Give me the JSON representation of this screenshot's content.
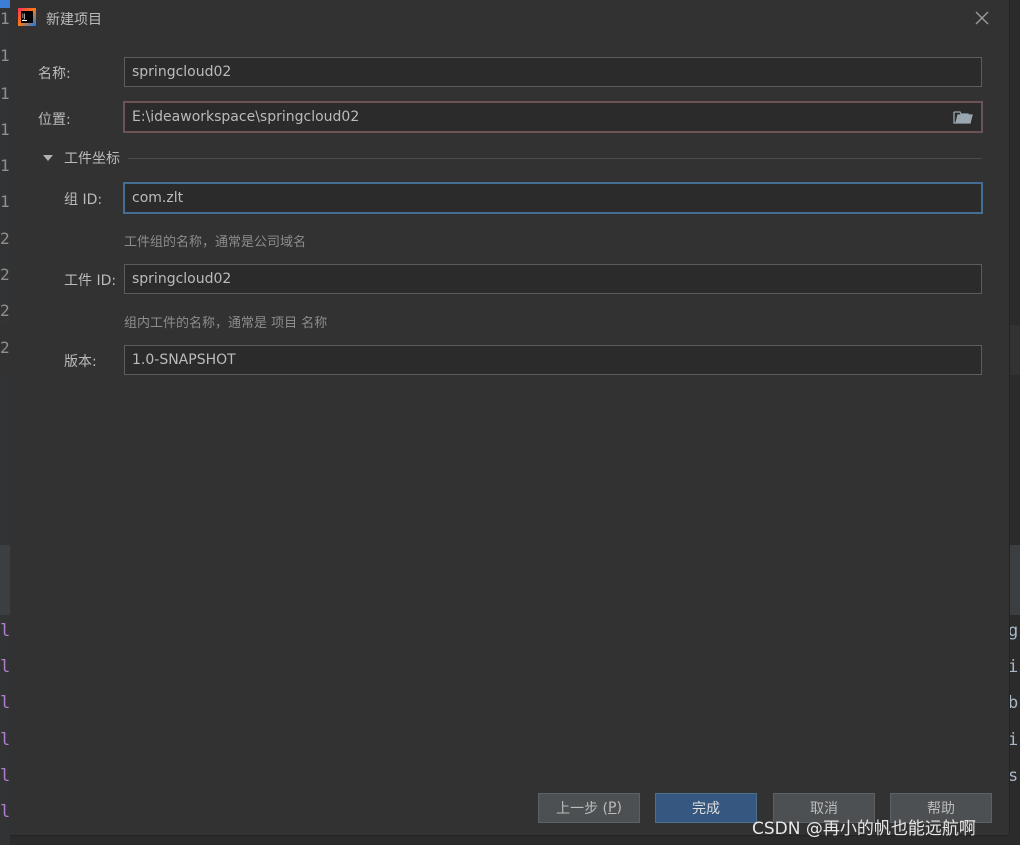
{
  "dialog": {
    "title": "新建项目",
    "icons": {
      "app": "intellij-idea-icon",
      "close": "close-icon",
      "folder": "folder-icon",
      "collapse": "triangle-down-icon"
    }
  },
  "form": {
    "name": {
      "label": "名称:",
      "value": "springcloud02"
    },
    "location": {
      "label": "位置:",
      "value": "E:\\ideaworkspace\\springcloud02"
    },
    "section": {
      "title": "工件坐标"
    },
    "group_id": {
      "label": "组 ID:",
      "value": "com.zlt",
      "hint": "工件组的名称，通常是公司域名"
    },
    "artifact_id": {
      "label": "工件 ID:",
      "value": "springcloud02",
      "hint": "组内工件的名称，通常是 项目 名称"
    },
    "version": {
      "label": "版本:",
      "value": "1.0-SNAPSHOT"
    }
  },
  "buttons": {
    "previous": {
      "label": "上一步 (",
      "mnemonic": "P",
      "suffix": ")"
    },
    "finish": "完成",
    "cancel": "取消",
    "help": "帮助"
  },
  "background": {
    "gutter_numbers": [
      "1",
      "1",
      "1",
      "1",
      "1",
      "1",
      "2",
      "2",
      "2"
    ],
    "gutter_letters": [
      "l",
      "l",
      "l",
      "l",
      "l",
      "l"
    ],
    "right_chars": [
      "g",
      "i",
      "b",
      "i",
      "s"
    ]
  },
  "watermark": "CSDN @再小的帆也能远航啊",
  "colors": {
    "dialog_bg": "#323232",
    "field_bg": "#2b2b2b",
    "primary_button": "#365880",
    "focus_border": "#466d94",
    "error_border": "#6b5356"
  }
}
